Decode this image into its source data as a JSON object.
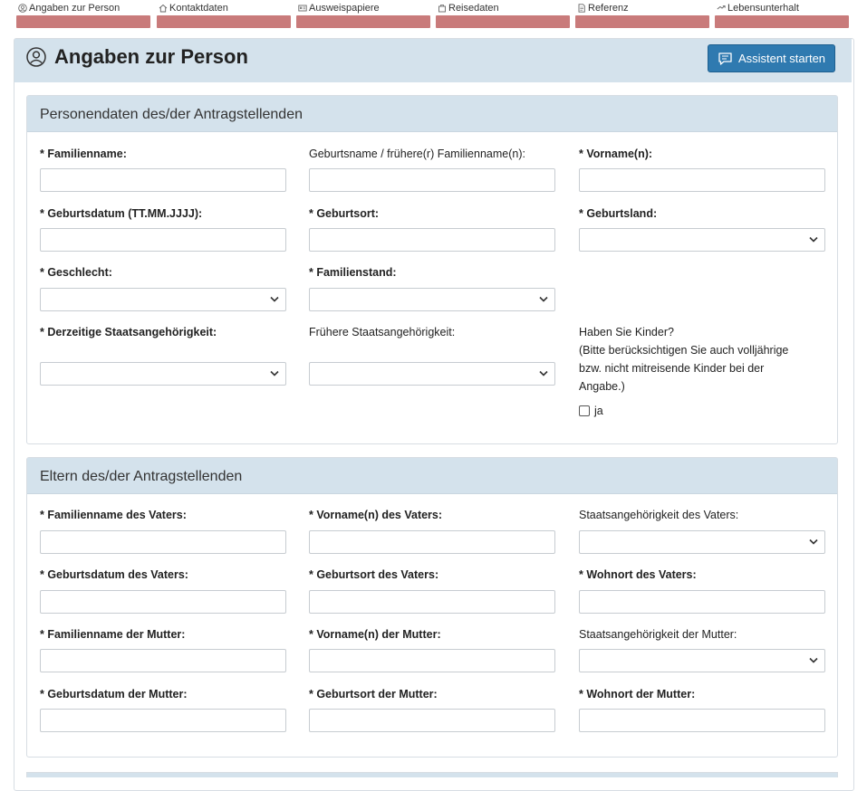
{
  "steps": [
    {
      "label": "Angaben zur Person",
      "icon": "user-circle-icon"
    },
    {
      "label": "Kontaktdaten",
      "icon": "home-icon"
    },
    {
      "label": "Ausweispapiere",
      "icon": "id-card-icon"
    },
    {
      "label": "Reisedaten",
      "icon": "luggage-icon"
    },
    {
      "label": "Referenz",
      "icon": "document-icon"
    },
    {
      "label": "Lebensunterhalt",
      "icon": "money-icon"
    }
  ],
  "page": {
    "title": "Angaben zur Person",
    "assistant_button": "Assistent starten"
  },
  "person_section": {
    "title": "Personendaten des/der Antragstellenden",
    "fields": {
      "familienname": "* Familienname:",
      "geburtsname": "Geburtsname / frühere(r) Familienname(n):",
      "vorname": "* Vorname(n):",
      "geburtsdatum": "* Geburtsdatum (TT.MM.JJJJ):",
      "geburtsort": "* Geburtsort:",
      "geburtsland": "* Geburtsland:",
      "geschlecht": "* Geschlecht:",
      "familienstand": "* Familienstand:",
      "staatsangehoerigkeit": "* Derzeitige Staatsangehörigkeit:",
      "fruehere_staatsangehoerigkeit": "Frühere Staatsangehörigkeit:"
    },
    "kinder": {
      "question": "Haben Sie Kinder?",
      "note_line1": "(Bitte berücksichtigen Sie auch volljährige",
      "note_line2": "bzw. nicht mitreisende Kinder bei der",
      "note_line3": "Angabe.)",
      "checkbox_label": "ja",
      "checked": false
    }
  },
  "parents_section": {
    "title": "Eltern des/der Antragstellenden",
    "fields": {
      "vater_familienname": "* Familienname des Vaters:",
      "vater_vorname": "* Vorname(n) des Vaters:",
      "vater_staatsangehoerigkeit": "Staatsangehörigkeit des Vaters:",
      "vater_geburtsdatum": "* Geburtsdatum des Vaters:",
      "vater_geburtsort": "* Geburtsort des Vaters:",
      "vater_wohnort": "* Wohnort des Vaters:",
      "mutter_familienname": "* Familienname der Mutter:",
      "mutter_vorname": "* Vorname(n) der Mutter:",
      "mutter_staatsangehoerigkeit": "Staatsangehörigkeit der Mutter:",
      "mutter_geburtsdatum": "* Geburtsdatum der Mutter:",
      "mutter_geburtsort": "* Geburtsort der Mutter:",
      "mutter_wohnort": "* Wohnort der Mutter:"
    }
  },
  "colors": {
    "step_bar": "#c97b7b",
    "header_bg": "#d4e2ec",
    "button_bg": "#2f7ab0"
  }
}
